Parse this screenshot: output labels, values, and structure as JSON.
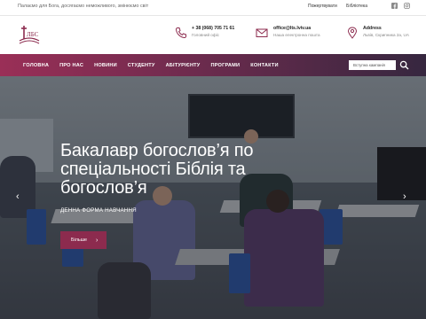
{
  "topbar": {
    "motto": "Палаємо для Бога, досягаємо неможливого, змінюємо світ",
    "links": [
      "Пожертвувати",
      "Бібліотека"
    ],
    "social_icons": [
      "facebook-icon",
      "instagram-icon"
    ]
  },
  "header": {
    "logo": "ЛБС",
    "phone": {
      "value": "+ 38 (068) 705 71 61",
      "label": "Головний офіс"
    },
    "email": {
      "value": "office@lts.lviv.ua",
      "label": "Наша електронна пошта"
    },
    "address": {
      "value": "Address",
      "label": "Львів, Скрипника 2а, UA"
    }
  },
  "nav": {
    "items": [
      "ГОЛОВНА",
      "ПРО НАС",
      "НОВИНИ",
      "СТУДЕНТУ",
      "АБІТУРІЄНТУ",
      "ПРОГРАМИ",
      "КОНТАКТИ"
    ],
    "search_placeholder": "Вступна кампанія"
  },
  "hero": {
    "title": "Бакалавр богослов’я по спеціальності Біблія та богослов’я",
    "subtitle": "ДЕННА ФОРМА НАВЧАННЯ",
    "button_label": "Більше",
    "button_arrow": "›",
    "prev_arrow": "‹",
    "next_arrow": "›"
  },
  "colors": {
    "accent": "#8c2b4e",
    "nav_gradient_start": "#9a2f57",
    "nav_gradient_end": "#36273f"
  }
}
